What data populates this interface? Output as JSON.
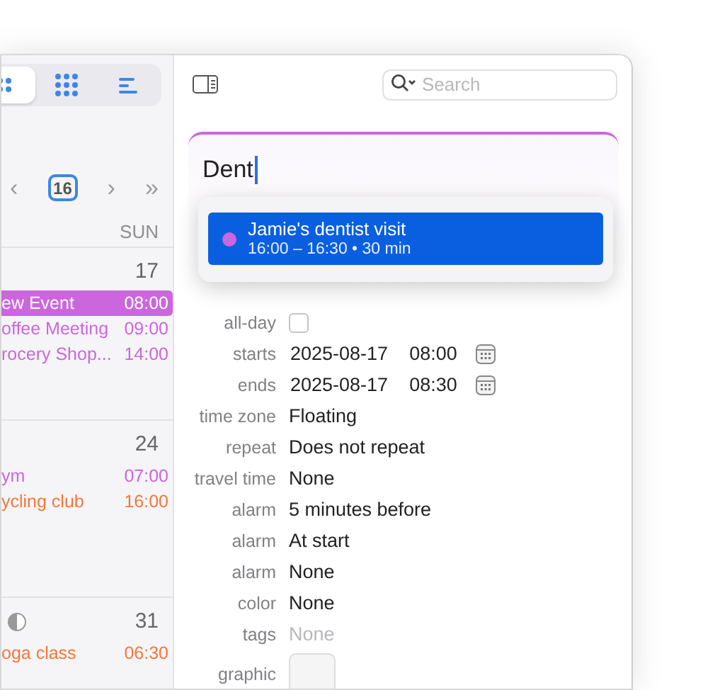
{
  "sidebar": {
    "view_buttons": [
      {
        "selected": true
      },
      {
        "selected": false
      },
      {
        "selected": false
      }
    ],
    "nav": {
      "prev": "‹",
      "today": "16",
      "next": "›",
      "next_far": "»"
    },
    "weekday": "SUN",
    "weeks": [
      {
        "day": "17",
        "moon_phase": false,
        "events": [
          {
            "title": "ew Event",
            "time": "08:00",
            "color": "#cc66dd",
            "selected": true
          },
          {
            "title": "offee Meeting",
            "time": "09:00",
            "color": "#cc66dd",
            "selected": false
          },
          {
            "title": "rocery Shop...",
            "time": "14:00",
            "color": "#cc66dd",
            "selected": false
          }
        ]
      },
      {
        "day": "24",
        "moon_phase": false,
        "events": [
          {
            "title": "ym",
            "time": "07:00",
            "color": "#cc66dd",
            "selected": false
          },
          {
            "title": "ycling club",
            "time": "16:00",
            "color": "#f4773a",
            "selected": false
          }
        ]
      },
      {
        "day": "31",
        "moon_phase": true,
        "events": [
          {
            "title": "oga class",
            "time": "06:30",
            "color": "#f4773a",
            "selected": false
          }
        ]
      }
    ]
  },
  "search": {
    "placeholder": "Search"
  },
  "title_field": {
    "value": "Dent",
    "color": "#cc66dd"
  },
  "suggestions": [
    {
      "title": "Jamie's dentist visit",
      "detail": "16:00 – 16:30 • 30 min",
      "color": "#cc66dd",
      "selected": true
    }
  ],
  "fields": [
    {
      "label": "all-day",
      "kind": "checkbox",
      "checked": false
    },
    {
      "label": "starts",
      "kind": "datetime",
      "date": "2025-08-17",
      "time": "08:00"
    },
    {
      "label": "ends",
      "kind": "datetime",
      "date": "2025-08-17",
      "time": "08:30"
    },
    {
      "label": "time zone",
      "kind": "text",
      "value": "Floating"
    },
    {
      "label": "repeat",
      "kind": "text",
      "value": "Does not repeat"
    },
    {
      "label": "travel time",
      "kind": "text",
      "value": "None"
    },
    {
      "label": "alarm",
      "kind": "text",
      "value": "5 minutes before"
    },
    {
      "label": "alarm",
      "kind": "text",
      "value": "At start"
    },
    {
      "label": "alarm",
      "kind": "text",
      "value": "None"
    },
    {
      "label": "color",
      "kind": "text",
      "value": "None"
    },
    {
      "label": "tags",
      "kind": "placeholder",
      "placeholder": "None"
    },
    {
      "label": "graphic",
      "kind": "image"
    }
  ]
}
